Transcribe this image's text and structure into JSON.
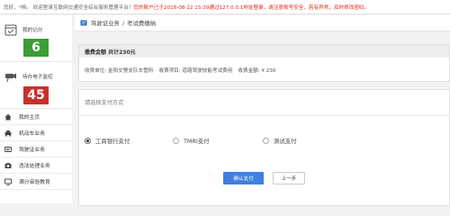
{
  "topbar": {
    "welcome": "您好，*桓。 欢迎登录互联网交通安全综合服务管理平台！",
    "notice": "您的账户已于2018-08-22 15:39通过127.0.0.1地址登录，请注意账号安全，若有异常，及时修改密码。"
  },
  "sidebar": {
    "score_label": "我的记分",
    "score_value": "6",
    "license_label": "待办电子监控",
    "license_value": "45",
    "items": [
      {
        "label": "我的主页"
      },
      {
        "label": "机动车业务"
      },
      {
        "label": "驾驶证业务"
      },
      {
        "label": "违法处理业务"
      },
      {
        "label": "满分审验教育"
      }
    ]
  },
  "breadcrumb": {
    "parent": "驾驶证业务",
    "separator": "/",
    "current": "考试费缴纳"
  },
  "fee": {
    "header": "缴费金额 共计230元",
    "unit": "收费单位: 金阳交警支队车管所",
    "item": "收费项目: 道路驾驶技能考试费用",
    "amount": "收费金额: ¥ 230"
  },
  "payment": {
    "title": "请选择支付方式",
    "options": [
      {
        "label": "工商银行支付",
        "selected": true
      },
      {
        "label": "TMRI支付",
        "selected": false
      },
      {
        "label": "测试支付",
        "selected": false
      }
    ],
    "confirm_label": "确认支付",
    "back_label": "上一步"
  },
  "colors": {
    "score_green": "#3d9d35",
    "license_red": "#c9302c",
    "primary_blue": "#3e7fe0",
    "notice_red": "#e2231a"
  }
}
